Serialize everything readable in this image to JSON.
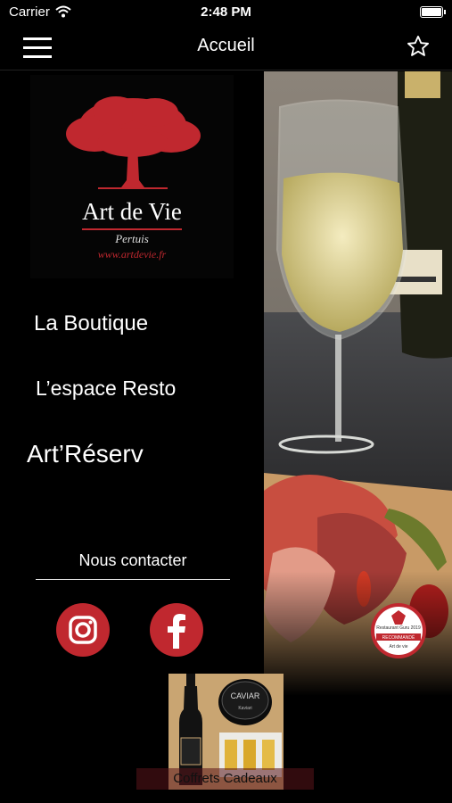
{
  "status_bar": {
    "carrier": "Carrier",
    "time": "2:48 PM"
  },
  "nav": {
    "title": "Accueil",
    "menu_icon": "hamburger-menu-icon",
    "favorite_icon": "star-icon"
  },
  "logo": {
    "brand": "Art de Vie",
    "city": "Pertuis",
    "url": "www.artdevie.fr"
  },
  "menu": {
    "items": [
      "La Boutique",
      "L’espace Resto",
      "Art’Réserv"
    ]
  },
  "contact": {
    "label": "Nous contacter",
    "instagram_icon": "instagram-icon",
    "facebook_icon": "facebook-icon"
  },
  "badge": {
    "top": "Restaurant Guru 2019",
    "middle": "RECOMMANDÉ",
    "bottom": "Art de vie"
  },
  "promo": {
    "caviar_top": "CAVIAR",
    "caviar_bottom": "Kaviari",
    "label": "Coffrets Cadeaux"
  },
  "colors": {
    "accent": "#c0282f",
    "background": "#000000"
  }
}
